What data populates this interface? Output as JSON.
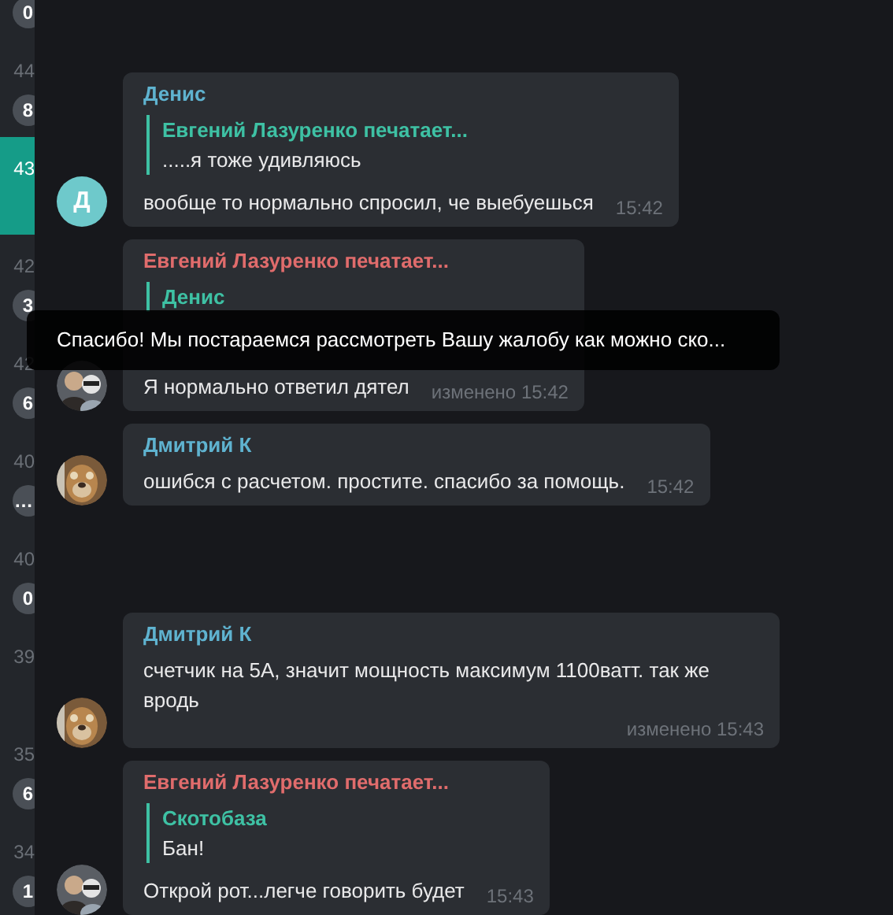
{
  "sidebar": {
    "items": [
      {
        "badge": "0",
        "selected": false
      },
      {
        "time": "44",
        "badge": "8",
        "selected": false
      },
      {
        "time": "43",
        "selected": true
      },
      {
        "time": "42",
        "badge": "3",
        "selected": false
      },
      {
        "time": "42",
        "badge": "6",
        "selected": false
      },
      {
        "time": "40",
        "badge": "…",
        "selected": false
      },
      {
        "time": "40",
        "badge": "0",
        "selected": false
      },
      {
        "time": "39",
        "selected": false
      },
      {
        "time": "35",
        "badge": "6",
        "selected": false
      },
      {
        "time": "34",
        "badge": "1",
        "selected": false
      }
    ]
  },
  "messages": [
    {
      "avatar": {
        "kind": "letter",
        "letter": "Д",
        "color": "#6ec9cb"
      },
      "sender": "Денис",
      "color": "#5fb3d0",
      "reply": {
        "name": "Евгений Лазуренко печатает...",
        "text": ".....я тоже удивляюсь"
      },
      "text": "вообще то нормально спросил, че выебуешься",
      "time": "15:42"
    },
    {
      "avatar": {
        "kind": "people"
      },
      "sender": "Евгений Лазуренко печатает...",
      "color": "#e06c6c",
      "reply": {
        "name": "Денис"
      },
      "text": "Я нормально ответил дятел",
      "time": "изменено 15:42"
    },
    {
      "avatar": {
        "kind": "dog"
      },
      "sender": "Дмитрий К",
      "color": "#5fb3d0",
      "text": "ошибся с расчетом. простите. спасибо за помощь.",
      "time": "15:42"
    },
    {
      "avatar": {
        "kind": "dog"
      },
      "sender": "Дмитрий К",
      "color": "#5fb3d0",
      "text": "счетчик на 5А, значит мощность максимум 1100ватт. так же вродь",
      "time": "изменено 15:43"
    },
    {
      "avatar": {
        "kind": "people"
      },
      "sender": "Евгений Лазуренко печатает...",
      "color": "#e06c6c",
      "reply": {
        "name": "Скотобаза",
        "text": "Бан!"
      },
      "text": "Открой рот...легче говорить будет",
      "time": "15:43"
    }
  ],
  "tooltip": {
    "text": "Спасибо! Мы постараемся рассмотреть Вашу жалобу как можно ско..."
  }
}
